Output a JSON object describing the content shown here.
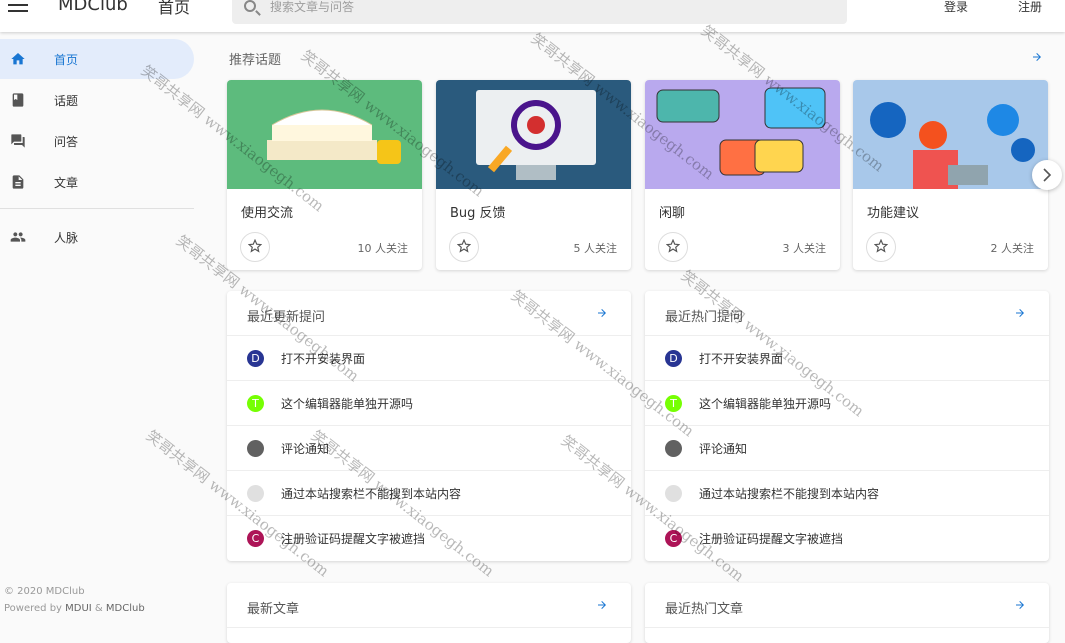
{
  "appbar": {
    "brand": "MDClub",
    "page_name": "首页",
    "search_placeholder": "搜索文章与问答",
    "login": "登录",
    "register": "注册"
  },
  "sidebar": {
    "items": [
      {
        "label": "首页",
        "icon": "home-icon",
        "active": true
      },
      {
        "label": "话题",
        "icon": "bookmark-icon"
      },
      {
        "label": "问答",
        "icon": "forum-icon"
      },
      {
        "label": "文章",
        "icon": "article-icon"
      },
      {
        "label": "人脉",
        "icon": "people-icon"
      }
    ],
    "footer_copy": "© 2020 MDClub",
    "footer_powered_prefix": "Powered by ",
    "footer_powered_mdui": "MDUI",
    "footer_powered_amp": " & ",
    "footer_powered_mdclub": "MDClub"
  },
  "topics": {
    "title": "推荐话题",
    "items": [
      {
        "name": "使用交流",
        "follow": "10 人关注",
        "bg": "#5dbb7d"
      },
      {
        "name": "Bug 反馈",
        "follow": "5 人关注",
        "bg": "#2a5a7d"
      },
      {
        "name": "闲聊",
        "follow": "3 人关注",
        "bg": "#b9a9ee"
      },
      {
        "name": "功能建议",
        "follow": "2 人关注",
        "bg": "#a8c8ea"
      }
    ]
  },
  "recent_questions": {
    "title": "最近更新提问",
    "items": [
      {
        "text": "打不开安装界面",
        "avatar": "D",
        "color": "#283593"
      },
      {
        "text": "这个编辑器能单独开源吗",
        "avatar": "T",
        "color": "#76ff03"
      },
      {
        "text": "评论通知",
        "avatar": "",
        "color": "#616161"
      },
      {
        "text": "通过本站搜索栏不能搜到本站内容",
        "avatar": "",
        "color": "#e0e0e0"
      },
      {
        "text": "注册验证码提醒文字被遮挡",
        "avatar": "C",
        "color": "#ad1457"
      }
    ]
  },
  "hot_questions": {
    "title": "最近热门提问",
    "items": [
      {
        "text": "打不开安装界面",
        "avatar": "D",
        "color": "#283593"
      },
      {
        "text": "这个编辑器能单独开源吗",
        "avatar": "T",
        "color": "#76ff03"
      },
      {
        "text": "评论通知",
        "avatar": "",
        "color": "#616161"
      },
      {
        "text": "通过本站搜索栏不能搜到本站内容",
        "avatar": "",
        "color": "#e0e0e0"
      },
      {
        "text": "注册验证码提醒文字被遮挡",
        "avatar": "C",
        "color": "#ad1457"
      }
    ]
  },
  "latest_articles": {
    "title": "最新文章"
  },
  "hot_articles": {
    "title": "最近热门文章"
  },
  "accent": "#1976d2",
  "watermark": {
    "cn": "笑哥共享网",
    "url": "www.xiaogegh.com"
  }
}
